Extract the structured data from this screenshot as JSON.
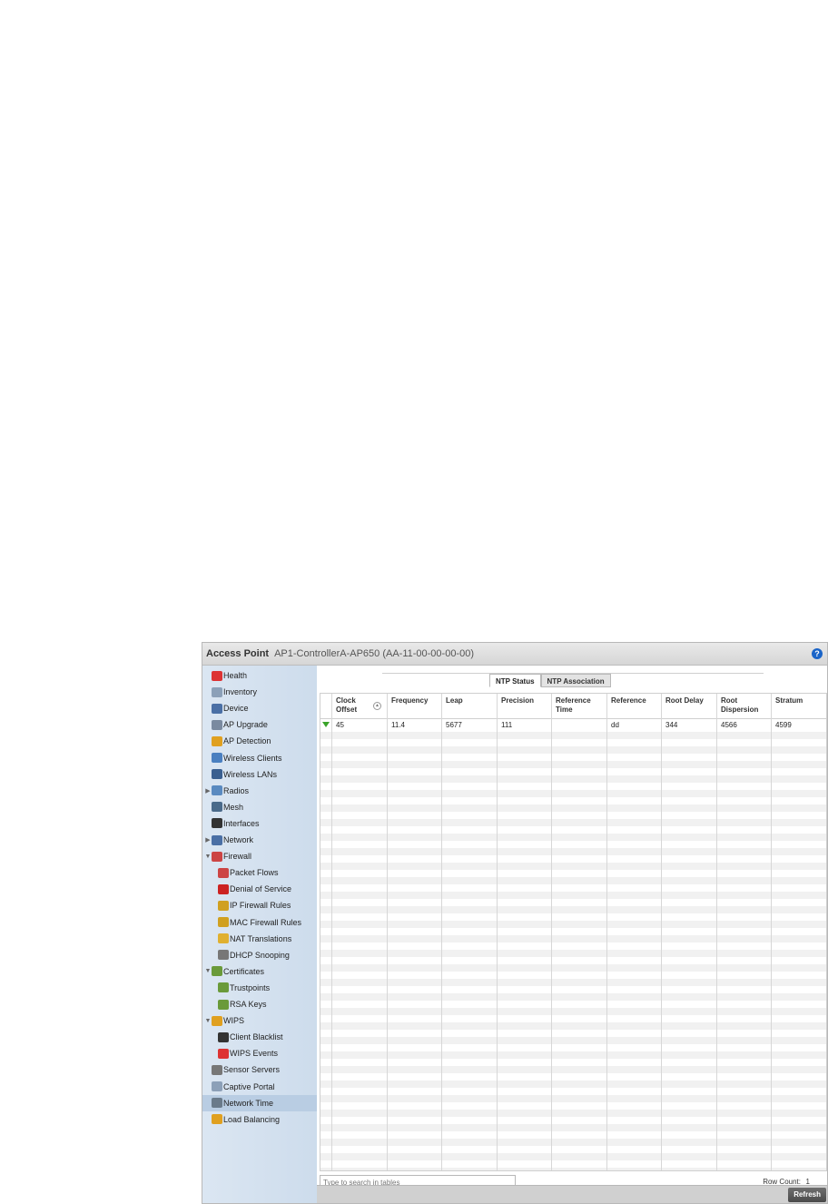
{
  "window": {
    "title": "Access Point",
    "subtitle": "AP1-ControllerA-AP650 (AA-11-00-00-00-00)",
    "help": "?"
  },
  "sidebar": {
    "items": [
      {
        "label": "Health",
        "icon": "health-icon",
        "color": "#d33"
      },
      {
        "label": "Inventory",
        "icon": "inventory-icon",
        "color": "#8ca0b8"
      },
      {
        "label": "Device",
        "icon": "device-icon",
        "color": "#4a6fa5"
      },
      {
        "label": "AP Upgrade",
        "icon": "ap-upgrade-icon",
        "color": "#7a8aa0"
      },
      {
        "label": "AP Detection",
        "icon": "ap-detection-icon",
        "color": "#e0a020"
      },
      {
        "label": "Wireless Clients",
        "icon": "wireless-clients-icon",
        "color": "#4a7fc0"
      },
      {
        "label": "Wireless LANs",
        "icon": "wireless-lans-icon",
        "color": "#3a5f90"
      },
      {
        "label": "Radios",
        "icon": "radios-icon",
        "color": "#5a8ac0",
        "expander": "▶"
      },
      {
        "label": "Mesh",
        "icon": "mesh-icon",
        "color": "#4a6a8a"
      },
      {
        "label": "Interfaces",
        "icon": "interfaces-icon",
        "color": "#333"
      },
      {
        "label": "Network",
        "icon": "network-icon",
        "color": "#4a6fa5",
        "expander": "▶"
      },
      {
        "label": "Firewall",
        "icon": "firewall-icon",
        "color": "#c44",
        "expander": "▼"
      },
      {
        "label": "Packet Flows",
        "icon": "packet-flows-icon",
        "color": "#c44",
        "indent": true
      },
      {
        "label": "Denial of Service",
        "icon": "denial-of-service-icon",
        "color": "#c22",
        "indent": true
      },
      {
        "label": "IP Firewall Rules",
        "icon": "ip-firewall-rules-icon",
        "color": "#d0a020",
        "indent": true
      },
      {
        "label": "MAC Firewall Rules",
        "icon": "mac-firewall-rules-icon",
        "color": "#d0a020",
        "indent": true
      },
      {
        "label": "NAT Translations",
        "icon": "nat-translations-icon",
        "color": "#e0b030",
        "indent": true
      },
      {
        "label": "DHCP Snooping",
        "icon": "dhcp-snooping-icon",
        "color": "#777",
        "indent": true
      },
      {
        "label": "Certificates",
        "icon": "certificates-icon",
        "color": "#6a9a3a",
        "expander": "▼"
      },
      {
        "label": "Trustpoints",
        "icon": "trustpoints-icon",
        "color": "#6a9a3a",
        "indent": true
      },
      {
        "label": "RSA Keys",
        "icon": "rsa-keys-icon",
        "color": "#6a9a3a",
        "indent": true
      },
      {
        "label": "WIPS",
        "icon": "wips-icon",
        "color": "#e0a020",
        "expander": "▼"
      },
      {
        "label": "Client Blacklist",
        "icon": "client-blacklist-icon",
        "color": "#333",
        "indent": true
      },
      {
        "label": "WIPS Events",
        "icon": "wips-events-icon",
        "color": "#d33",
        "indent": true
      },
      {
        "label": "Sensor Servers",
        "icon": "sensor-servers-icon",
        "color": "#777"
      },
      {
        "label": "Captive Portal",
        "icon": "captive-portal-icon",
        "color": "#8ca0b8"
      },
      {
        "label": "Network Time",
        "icon": "network-time-icon",
        "color": "#6a7a8a",
        "selected": true
      },
      {
        "label": "Load Balancing",
        "icon": "load-balancing-icon",
        "color": "#e0a020"
      }
    ]
  },
  "tabs": [
    {
      "label": "NTP Status",
      "active": true
    },
    {
      "label": "NTP Association",
      "active": false
    }
  ],
  "table": {
    "columns": [
      "Clock Offset",
      "Frequency",
      "Leap",
      "Precision",
      "Reference Time",
      "Reference",
      "Root Delay",
      "Root Dispersion",
      "Stratum"
    ],
    "rows": [
      {
        "status": "ok",
        "cells": [
          "45",
          "11.4",
          "5677",
          "111",
          "",
          "dd",
          "344",
          "4566",
          "4599"
        ]
      }
    ]
  },
  "search": {
    "placeholder": "Type to search in tables"
  },
  "row_count": {
    "label": "Row Count:",
    "value": "1"
  },
  "footer": {
    "refresh_label": "Refresh"
  }
}
